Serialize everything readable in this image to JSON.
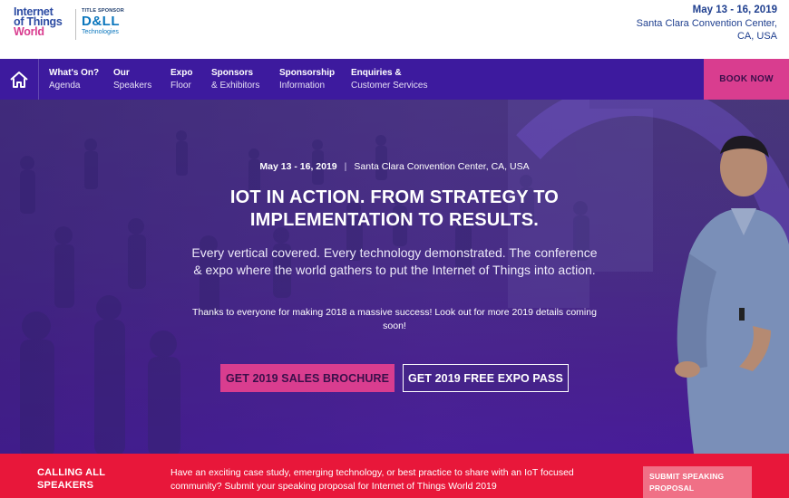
{
  "header": {
    "logo": {
      "line1": "Internet",
      "line2": "of Things",
      "line3": "World"
    },
    "sponsor": {
      "tag": "TITLE SPONSOR",
      "brand": "D&LL",
      "sub": "Technologies"
    },
    "event_date": "May 13 - 16, 2019",
    "event_venue": "Santa Clara Convention Center, CA, USA"
  },
  "nav": {
    "items": [
      {
        "top": "What's On?",
        "bottom": "Agenda"
      },
      {
        "top": "Our",
        "bottom": "Speakers"
      },
      {
        "top": "Expo",
        "bottom": "Floor"
      },
      {
        "top": "Sponsors",
        "bottom": "& Exhibitors"
      },
      {
        "top": "Sponsorship",
        "bottom": "Information"
      },
      {
        "top": "Enquiries &",
        "bottom": "Customer Services"
      }
    ],
    "book_label": "BOOK NOW"
  },
  "hero": {
    "date": "May 13 - 16, 2019",
    "separator": "|",
    "venue": "Santa Clara Convention Center, CA, USA",
    "title_line1": "IOT IN ACTION. FROM STRATEGY TO",
    "title_line2": "IMPLEMENTATION TO RESULTS.",
    "description": "Every vertical covered. Every technology demonstrated. The conference & expo where the world gathers to put the Internet of Things into action.",
    "note": "Thanks to everyone for making 2018 a massive success! Look out for more 2019 details coming soon!",
    "brochure_button": "GET 2019 SALES BROCHURE",
    "expo_button": "GET 2019 FREE EXPO PASS"
  },
  "cta": {
    "heading_line1": "CALLING ALL",
    "heading_line2": "SPEAKERS",
    "text": "Have an exciting case study, emerging technology, or best practice to share with an IoT focused community? Submit your speaking proposal for Internet of Things World 2019",
    "submit_line1": "SUBMIT SPEAKING",
    "submit_line2": "PROPOSAL"
  },
  "colors": {
    "nav_bg": "#3d1a9e",
    "accent_pink": "#d93d8f",
    "cta_red": "#e8173a",
    "brand_blue": "#1f3f8f"
  }
}
